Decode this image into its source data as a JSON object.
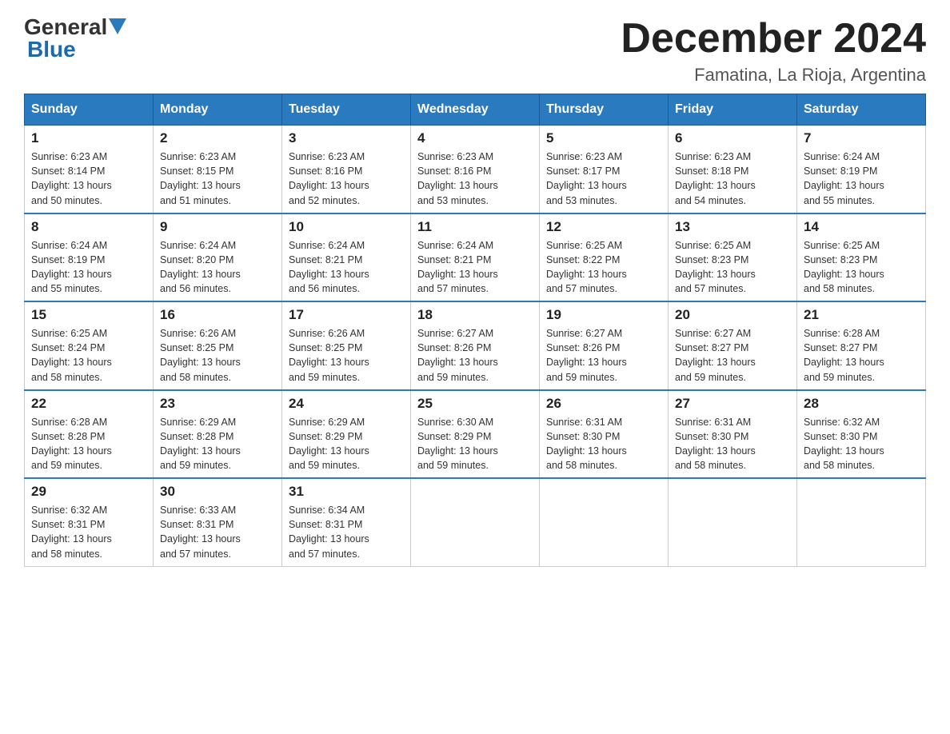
{
  "header": {
    "logo_general": "General",
    "logo_blue": "Blue",
    "month_year": "December 2024",
    "location": "Famatina, La Rioja, Argentina"
  },
  "days_of_week": [
    "Sunday",
    "Monday",
    "Tuesday",
    "Wednesday",
    "Thursday",
    "Friday",
    "Saturday"
  ],
  "weeks": [
    [
      {
        "day": "1",
        "sunrise": "6:23 AM",
        "sunset": "8:14 PM",
        "daylight": "13 hours and 50 minutes."
      },
      {
        "day": "2",
        "sunrise": "6:23 AM",
        "sunset": "8:15 PM",
        "daylight": "13 hours and 51 minutes."
      },
      {
        "day": "3",
        "sunrise": "6:23 AM",
        "sunset": "8:16 PM",
        "daylight": "13 hours and 52 minutes."
      },
      {
        "day": "4",
        "sunrise": "6:23 AM",
        "sunset": "8:16 PM",
        "daylight": "13 hours and 53 minutes."
      },
      {
        "day": "5",
        "sunrise": "6:23 AM",
        "sunset": "8:17 PM",
        "daylight": "13 hours and 53 minutes."
      },
      {
        "day": "6",
        "sunrise": "6:23 AM",
        "sunset": "8:18 PM",
        "daylight": "13 hours and 54 minutes."
      },
      {
        "day": "7",
        "sunrise": "6:24 AM",
        "sunset": "8:19 PM",
        "daylight": "13 hours and 55 minutes."
      }
    ],
    [
      {
        "day": "8",
        "sunrise": "6:24 AM",
        "sunset": "8:19 PM",
        "daylight": "13 hours and 55 minutes."
      },
      {
        "day": "9",
        "sunrise": "6:24 AM",
        "sunset": "8:20 PM",
        "daylight": "13 hours and 56 minutes."
      },
      {
        "day": "10",
        "sunrise": "6:24 AM",
        "sunset": "8:21 PM",
        "daylight": "13 hours and 56 minutes."
      },
      {
        "day": "11",
        "sunrise": "6:24 AM",
        "sunset": "8:21 PM",
        "daylight": "13 hours and 57 minutes."
      },
      {
        "day": "12",
        "sunrise": "6:25 AM",
        "sunset": "8:22 PM",
        "daylight": "13 hours and 57 minutes."
      },
      {
        "day": "13",
        "sunrise": "6:25 AM",
        "sunset": "8:23 PM",
        "daylight": "13 hours and 57 minutes."
      },
      {
        "day": "14",
        "sunrise": "6:25 AM",
        "sunset": "8:23 PM",
        "daylight": "13 hours and 58 minutes."
      }
    ],
    [
      {
        "day": "15",
        "sunrise": "6:25 AM",
        "sunset": "8:24 PM",
        "daylight": "13 hours and 58 minutes."
      },
      {
        "day": "16",
        "sunrise": "6:26 AM",
        "sunset": "8:25 PM",
        "daylight": "13 hours and 58 minutes."
      },
      {
        "day": "17",
        "sunrise": "6:26 AM",
        "sunset": "8:25 PM",
        "daylight": "13 hours and 59 minutes."
      },
      {
        "day": "18",
        "sunrise": "6:27 AM",
        "sunset": "8:26 PM",
        "daylight": "13 hours and 59 minutes."
      },
      {
        "day": "19",
        "sunrise": "6:27 AM",
        "sunset": "8:26 PM",
        "daylight": "13 hours and 59 minutes."
      },
      {
        "day": "20",
        "sunrise": "6:27 AM",
        "sunset": "8:27 PM",
        "daylight": "13 hours and 59 minutes."
      },
      {
        "day": "21",
        "sunrise": "6:28 AM",
        "sunset": "8:27 PM",
        "daylight": "13 hours and 59 minutes."
      }
    ],
    [
      {
        "day": "22",
        "sunrise": "6:28 AM",
        "sunset": "8:28 PM",
        "daylight": "13 hours and 59 minutes."
      },
      {
        "day": "23",
        "sunrise": "6:29 AM",
        "sunset": "8:28 PM",
        "daylight": "13 hours and 59 minutes."
      },
      {
        "day": "24",
        "sunrise": "6:29 AM",
        "sunset": "8:29 PM",
        "daylight": "13 hours and 59 minutes."
      },
      {
        "day": "25",
        "sunrise": "6:30 AM",
        "sunset": "8:29 PM",
        "daylight": "13 hours and 59 minutes."
      },
      {
        "day": "26",
        "sunrise": "6:31 AM",
        "sunset": "8:30 PM",
        "daylight": "13 hours and 58 minutes."
      },
      {
        "day": "27",
        "sunrise": "6:31 AM",
        "sunset": "8:30 PM",
        "daylight": "13 hours and 58 minutes."
      },
      {
        "day": "28",
        "sunrise": "6:32 AM",
        "sunset": "8:30 PM",
        "daylight": "13 hours and 58 minutes."
      }
    ],
    [
      {
        "day": "29",
        "sunrise": "6:32 AM",
        "sunset": "8:31 PM",
        "daylight": "13 hours and 58 minutes."
      },
      {
        "day": "30",
        "sunrise": "6:33 AM",
        "sunset": "8:31 PM",
        "daylight": "13 hours and 57 minutes."
      },
      {
        "day": "31",
        "sunrise": "6:34 AM",
        "sunset": "8:31 PM",
        "daylight": "13 hours and 57 minutes."
      },
      {
        "day": "",
        "sunrise": "",
        "sunset": "",
        "daylight": ""
      },
      {
        "day": "",
        "sunrise": "",
        "sunset": "",
        "daylight": ""
      },
      {
        "day": "",
        "sunrise": "",
        "sunset": "",
        "daylight": ""
      },
      {
        "day": "",
        "sunrise": "",
        "sunset": "",
        "daylight": ""
      }
    ]
  ],
  "labels": {
    "sunrise": "Sunrise:",
    "sunset": "Sunset:",
    "daylight": "Daylight:"
  }
}
